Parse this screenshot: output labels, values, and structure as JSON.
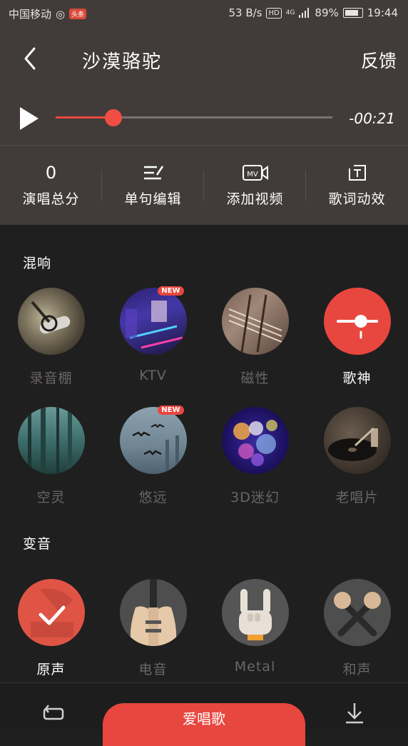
{
  "status_bar": {
    "carrier": "中国移动",
    "toutiao": "头条",
    "speed": "53 B/s",
    "hd": "HD",
    "network": "4G",
    "battery": "89%",
    "time": "19:44"
  },
  "header": {
    "title": "沙漠骆驼",
    "feedback": "反馈",
    "time_remaining": "-00:21",
    "progress": 0.21
  },
  "tools": [
    {
      "value": "0",
      "label": "演唱总分",
      "icon": "score"
    },
    {
      "label": "单句编辑",
      "icon": "edit-lines-icon"
    },
    {
      "label": "添加视频",
      "icon": "mv-camera-icon"
    },
    {
      "label": "歌词动效",
      "icon": "text-frame-icon"
    }
  ],
  "reverb": {
    "title": "混响",
    "items": [
      {
        "label": "录音棚",
        "icon": "microphone-image",
        "new": false,
        "active": false
      },
      {
        "label": "KTV",
        "icon": "ktv-room-image",
        "new": true,
        "new_label": "NEW",
        "active": false
      },
      {
        "label": "磁性",
        "icon": "guitar-image",
        "new": false,
        "active": false
      },
      {
        "label": "歌神",
        "icon": "slider-selected-icon",
        "new": false,
        "active": true
      },
      {
        "label": "空灵",
        "icon": "forest-image",
        "new": false,
        "active": false
      },
      {
        "label": "悠远",
        "icon": "birds-sky-image",
        "new": true,
        "new_label": "NEW",
        "active": false
      },
      {
        "label": "3D迷幻",
        "icon": "bokeh-image",
        "new": false,
        "active": false
      },
      {
        "label": "老唱片",
        "icon": "record-player-image",
        "new": false,
        "active": false
      }
    ]
  },
  "voice_change": {
    "title": "变音",
    "items": [
      {
        "label": "原声",
        "icon": "gramophone-check-icon",
        "active": true
      },
      {
        "label": "电音",
        "icon": "electric-guitar-icon",
        "active": false
      },
      {
        "label": "Metal",
        "icon": "rock-hand-icon",
        "active": false
      },
      {
        "label": "和声",
        "icon": "double-mic-icon",
        "active": false
      }
    ]
  },
  "bottom": {
    "main_button": "爱唱歌"
  },
  "colors": {
    "accent": "#e8473f",
    "header_bg": "#413c3a",
    "body_bg": "#1f1f1f"
  }
}
